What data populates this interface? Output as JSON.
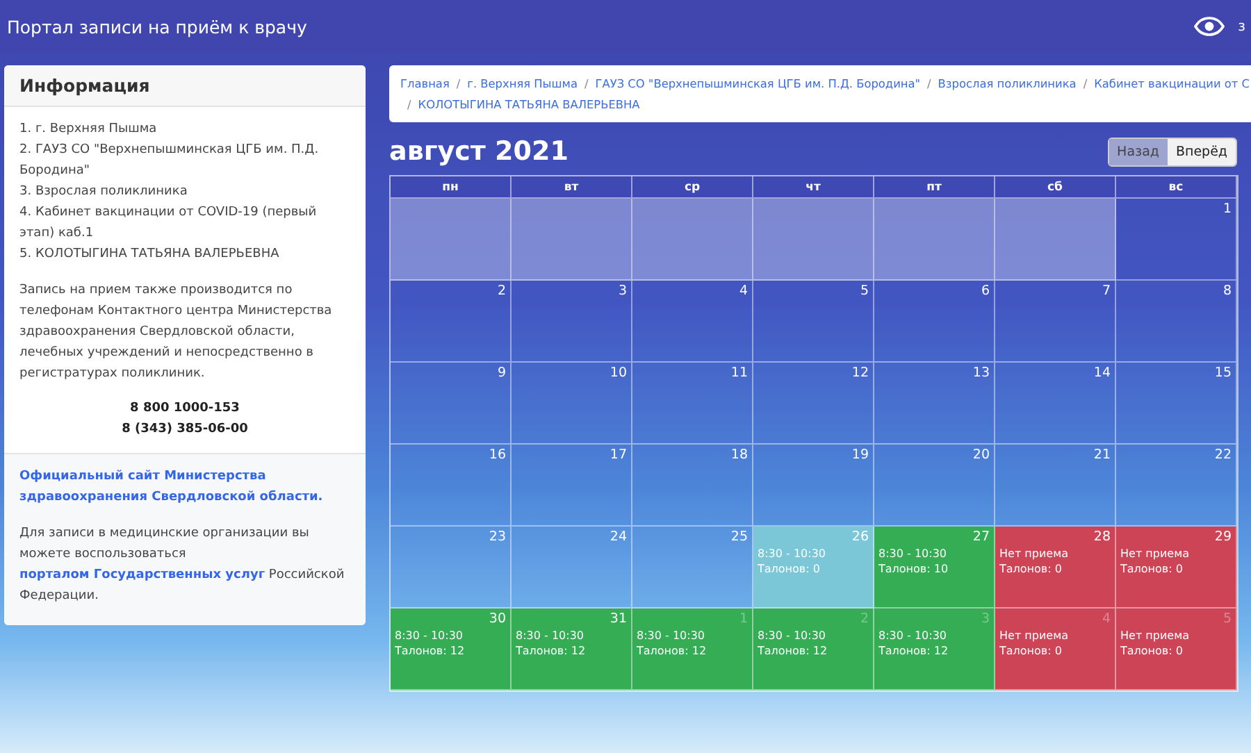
{
  "header": {
    "title": "Портал записи на приём к врачу",
    "cut_text": "з"
  },
  "info": {
    "title": "Информация",
    "lines": [
      "1. г. Верхняя Пышма",
      "2. ГАУЗ СО \"Верхнепышминская ЦГБ им. П.Д. Бородина\"",
      "3. Взрослая поликлиника",
      "4. Кабинет вакцинации от COVID-19 (первый этап) каб.1",
      "5. КОЛОТЫГИНА ТАТЬЯНА ВАЛЕРЬЕВНА"
    ],
    "note": "Запись на прием также производится по телефонам Контактного центра Министерства здравоохранения Свердловской области, лечебных учреждений и непосредственно в регистратурах поликлиник.",
    "phones": [
      "8 800 1000-153",
      "8 (343) 385-06-00"
    ],
    "ministry_link": "Официальный сайт Министерства здравоохранения Свердловской области.",
    "gosuslugi": {
      "before": "Для записи в медицинские организации вы можете воспользоваться",
      "link": "порталом Государственных услуг",
      "after": "Российской Федерации."
    }
  },
  "breadcrumb": [
    {
      "label": "Главная"
    },
    {
      "separator": "/",
      "label": "г. Верхняя Пышма"
    },
    {
      "separator": "/",
      "label": "ГАУЗ СО \"Верхнепышминская ЦГБ им. П.Д. Бородина\""
    },
    {
      "separator": "/",
      "label": "Взрослая поликлиника"
    },
    {
      "separator": "/",
      "label": "Кабинет вакцинации от С"
    },
    {
      "separator": "/",
      "label": "КОЛОТЫГИНА ТАТЬЯНА ВАЛЕРЬЕВНА"
    }
  ],
  "calendar": {
    "title": "август 2021",
    "buttons": [
      {
        "label": "Назад",
        "selected": true
      },
      {
        "label": "Вперёд",
        "selected": false
      }
    ],
    "weekdays": [
      "пн",
      "вт",
      "ср",
      "чт",
      "пт",
      "сб",
      "вс"
    ],
    "weeks": [
      [
        {
          "kind": "blank"
        },
        {
          "kind": "blank"
        },
        {
          "kind": "blank"
        },
        {
          "kind": "blank"
        },
        {
          "kind": "blank"
        },
        {
          "kind": "blank"
        },
        {
          "kind": "plain",
          "day": "1",
          "other_month": false
        }
      ],
      [
        {
          "kind": "plain",
          "day": "2",
          "other_month": false
        },
        {
          "kind": "plain",
          "day": "3",
          "other_month": false
        },
        {
          "kind": "plain",
          "day": "4",
          "other_month": false
        },
        {
          "kind": "plain",
          "day": "5",
          "other_month": false
        },
        {
          "kind": "plain",
          "day": "6",
          "other_month": false
        },
        {
          "kind": "plain",
          "day": "7",
          "other_month": false
        },
        {
          "kind": "plain",
          "day": "8",
          "other_month": false
        }
      ],
      [
        {
          "kind": "plain",
          "day": "9",
          "other_month": false
        },
        {
          "kind": "plain",
          "day": "10",
          "other_month": false
        },
        {
          "kind": "plain",
          "day": "11",
          "other_month": false
        },
        {
          "kind": "plain",
          "day": "12",
          "other_month": false
        },
        {
          "kind": "plain",
          "day": "13",
          "other_month": false
        },
        {
          "kind": "plain",
          "day": "14",
          "other_month": false
        },
        {
          "kind": "plain",
          "day": "15",
          "other_month": false
        }
      ],
      [
        {
          "kind": "plain",
          "day": "16",
          "other_month": false
        },
        {
          "kind": "plain",
          "day": "17",
          "other_month": false
        },
        {
          "kind": "plain",
          "day": "18",
          "other_month": false
        },
        {
          "kind": "plain",
          "day": "19",
          "other_month": false
        },
        {
          "kind": "plain",
          "day": "20",
          "other_month": false
        },
        {
          "kind": "plain",
          "day": "21",
          "other_month": false
        },
        {
          "kind": "plain",
          "day": "22",
          "other_month": false
        }
      ],
      [
        {
          "kind": "plain",
          "day": "23",
          "other_month": false
        },
        {
          "kind": "plain",
          "day": "24",
          "other_month": false
        },
        {
          "kind": "plain",
          "day": "25",
          "other_month": false
        },
        {
          "kind": "full",
          "day": "26",
          "other_month": false,
          "time": "8:30 - 10:30",
          "tickets": "Талонов: 0"
        },
        {
          "kind": "open",
          "day": "27",
          "other_month": false,
          "time": "8:30 - 10:30",
          "tickets": "Талонов: 10"
        },
        {
          "kind": "closed",
          "day": "28",
          "other_month": false,
          "time": "Нет приема",
          "tickets": "Талонов: 0"
        },
        {
          "kind": "closed",
          "day": "29",
          "other_month": false,
          "time": "Нет приема",
          "tickets": "Талонов: 0"
        }
      ],
      [
        {
          "kind": "open",
          "day": "30",
          "other_month": false,
          "time": "8:30 - 10:30",
          "tickets": "Талонов: 12"
        },
        {
          "kind": "open",
          "day": "31",
          "other_month": false,
          "time": "8:30 - 10:30",
          "tickets": "Талонов: 12"
        },
        {
          "kind": "open",
          "day": "1",
          "other_month": true,
          "time": "8:30 - 10:30",
          "tickets": "Талонов: 12"
        },
        {
          "kind": "open",
          "day": "2",
          "other_month": true,
          "time": "8:30 - 10:30",
          "tickets": "Талонов: 12"
        },
        {
          "kind": "open",
          "day": "3",
          "other_month": true,
          "time": "8:30 - 10:30",
          "tickets": "Талонов: 12"
        },
        {
          "kind": "closed",
          "day": "4",
          "other_month": true,
          "time": "Нет приема",
          "tickets": "Талонов: 0"
        },
        {
          "kind": "closed",
          "day": "5",
          "other_month": true,
          "time": "Нет приема",
          "tickets": "Талонов: 0"
        }
      ]
    ]
  }
}
